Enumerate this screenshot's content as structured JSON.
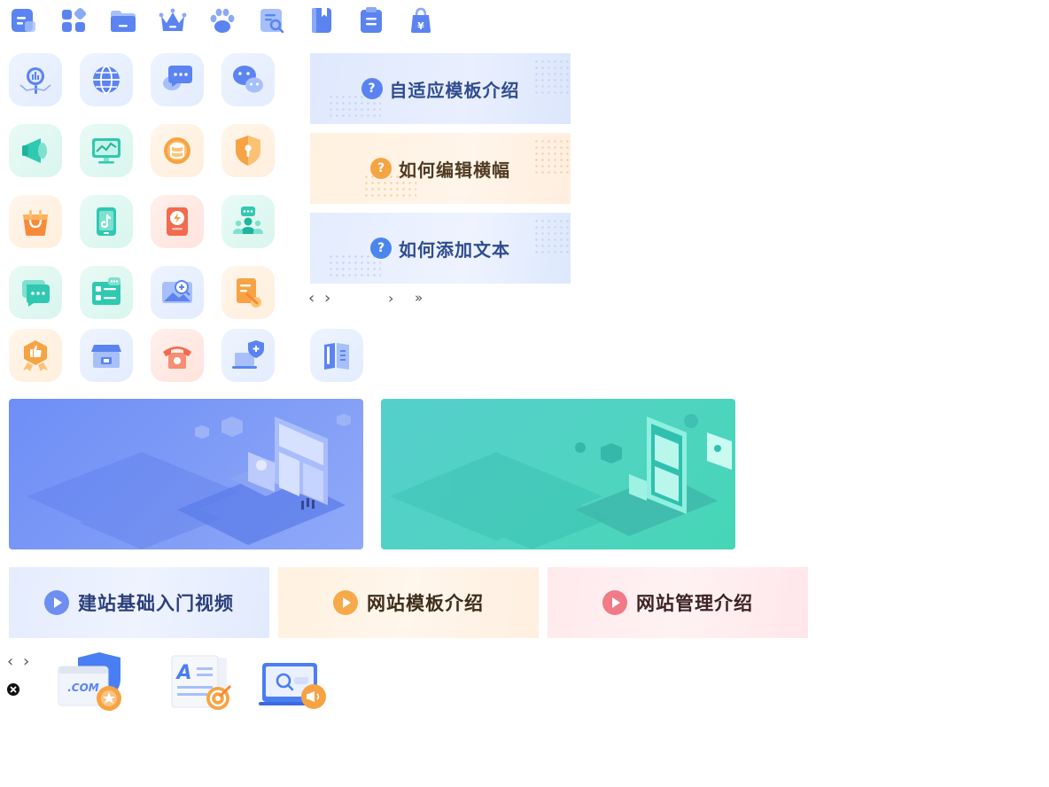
{
  "top_icons": [
    "doc-list-icon",
    "apps-grid-icon",
    "folder-icon",
    "crown-icon",
    "paw-icon",
    "search-doc-icon",
    "bookmark-book-icon",
    "notepad-icon",
    "money-bag-icon"
  ],
  "tiles": [
    "analytics-magnifier-icon",
    "globe-icon",
    "chat-bubbles-icon",
    "wechat-icon",
    "megaphone-icon",
    "monitor-chart-icon",
    "database-coin-icon",
    "security-shield-icon",
    "shopping-bag-icon",
    "tiktok-phone-icon",
    "flash-app-icon",
    "team-users-icon",
    "message-icon",
    "list-form-icon",
    "image-zoom-icon",
    "note-edit-icon",
    "award-badge-icon",
    "store-icon",
    "telephone-icon",
    "laptop-shield-icon",
    "book-icon"
  ],
  "help_banners": [
    {
      "text": "自适应模板介绍",
      "icon": "?",
      "color": "#5b83f0"
    },
    {
      "text": "如何编辑横幅",
      "icon": "?",
      "color": "#f5a443"
    },
    {
      "text": "如何添加文本",
      "icon": "?",
      "color": "#4b86ee"
    }
  ],
  "video_banners": [
    {
      "text": "建站基础入门视频",
      "color": "#6e8ef2"
    },
    {
      "text": "网站模板介绍",
      "color": "#f6a949"
    },
    {
      "text": "网站管理介绍",
      "color": "#f07a86"
    }
  ],
  "illustrations": {
    "left": {
      "color": "#6f8ef7"
    },
    "right": {
      "color": "#4fd4c0"
    }
  },
  "domain_label": ".COM",
  "doc_letter": "A",
  "nav": {
    "prev": "‹",
    "next": "›",
    "last": "»"
  }
}
